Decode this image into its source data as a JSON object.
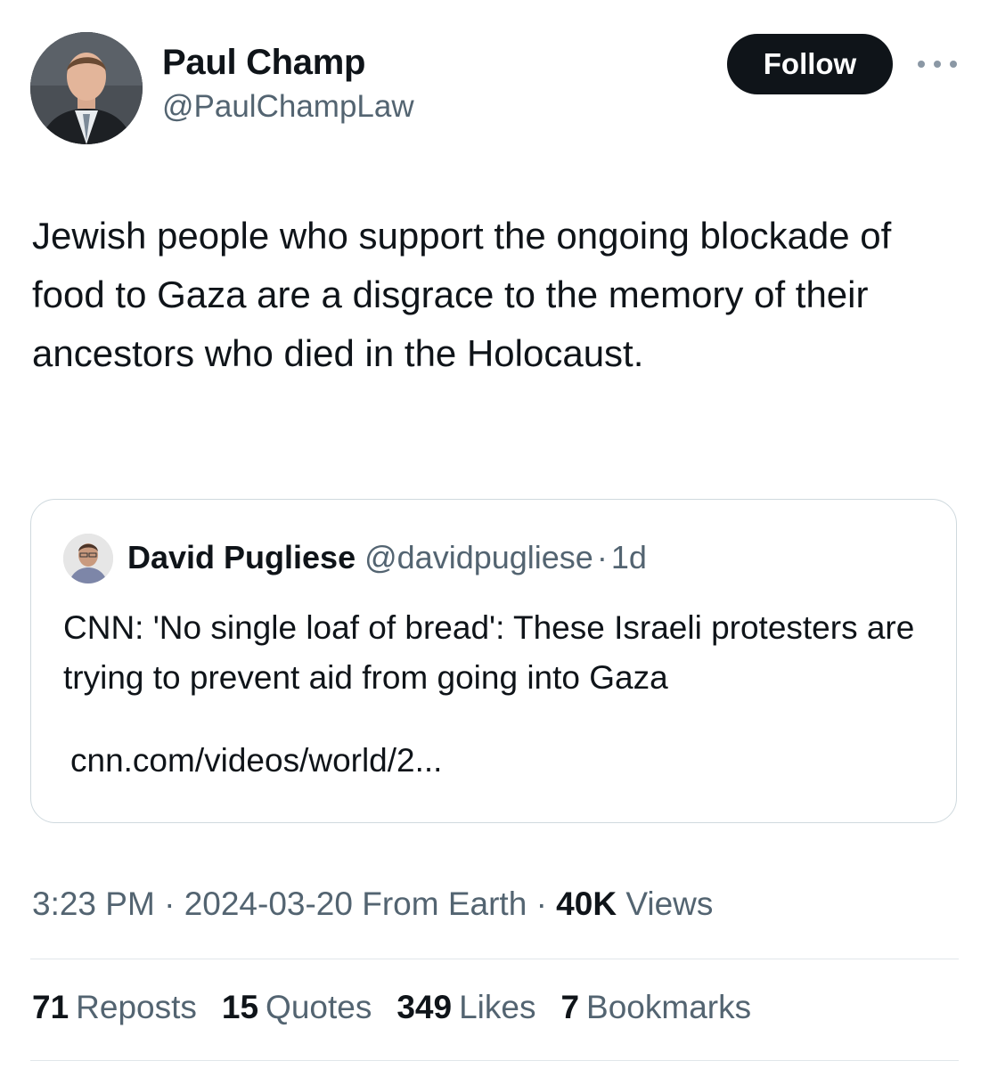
{
  "author": {
    "name": "Paul Champ",
    "handle": "@PaulChampLaw"
  },
  "follow_label": "Follow",
  "more_icon": "more-horizontal-icon",
  "tweet_text": "Jewish people who support the ongoing blockade of food to Gaza are a disgrace to the memory of their ancestors who died in the Holocaust.",
  "quoted": {
    "name": "David Pugliese",
    "handle": "@davidpugliese",
    "separator": "·",
    "time": "1d",
    "text": "CNN: 'No single loaf of bread': These Israeli protesters are trying to prevent aid from going into Gaza",
    "link": "cnn.com/videos/world/2..."
  },
  "meta": {
    "time": "3:23 PM",
    "sep1": "·",
    "date_source": "2024-03-20 From Earth",
    "sep2": "·",
    "views_count": "40K",
    "views_label": "Views"
  },
  "stats": {
    "reposts_count": "71",
    "reposts_label": "Reposts",
    "quotes_count": "15",
    "quotes_label": "Quotes",
    "likes_count": "349",
    "likes_label": "Likes",
    "bookmarks_count": "7",
    "bookmarks_label": "Bookmarks"
  },
  "colors": {
    "text": "#0f1419",
    "secondary": "#536471",
    "button_bg": "#0f1419",
    "border": "#cfd9de"
  }
}
